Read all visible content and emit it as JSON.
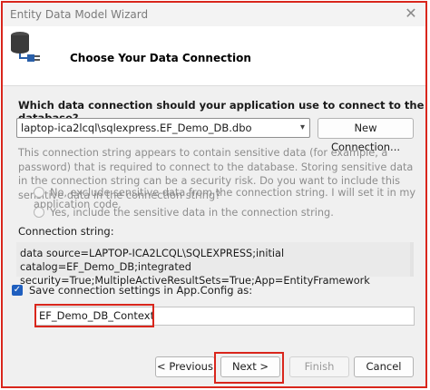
{
  "window": {
    "title": "Entity Data Model Wizard",
    "close_glyph": "✕"
  },
  "header": {
    "title": "Choose Your Data Connection",
    "icon": "database-plug-icon"
  },
  "connection": {
    "question": "Which data connection should your application use to connect to the database?",
    "selected": "laptop-ica2lcql\\sqlexpress.EF_Demo_DB.dbo",
    "new_connection_label": "New Connection..."
  },
  "sensitive": {
    "note": "This connection string appears to contain sensitive data (for example, a password) that is required to connect to the database. Storing sensitive data in the connection string can be a security risk. Do you want to include this sensitive data in the connection string?",
    "option_exclude": "No, exclude sensitive data from the connection string. I will set it in my application code.",
    "option_include": "Yes, include the sensitive data in the connection string."
  },
  "connection_string": {
    "label": "Connection string:",
    "value": "data source=LAPTOP-ICA2LCQL\\SQLEXPRESS;initial catalog=EF_Demo_DB;integrated security=True;MultipleActiveResultSets=True;App=EntityFramework"
  },
  "save_settings": {
    "checked": true,
    "label": "Save connection settings in App.Config as:",
    "value": "EF_Demo_DB_Context"
  },
  "footer": {
    "previous": "< Previous",
    "next": "Next >",
    "finish": "Finish",
    "cancel": "Cancel"
  },
  "colors": {
    "highlight": "#d9261c",
    "checkbox": "#1f5fbf"
  }
}
